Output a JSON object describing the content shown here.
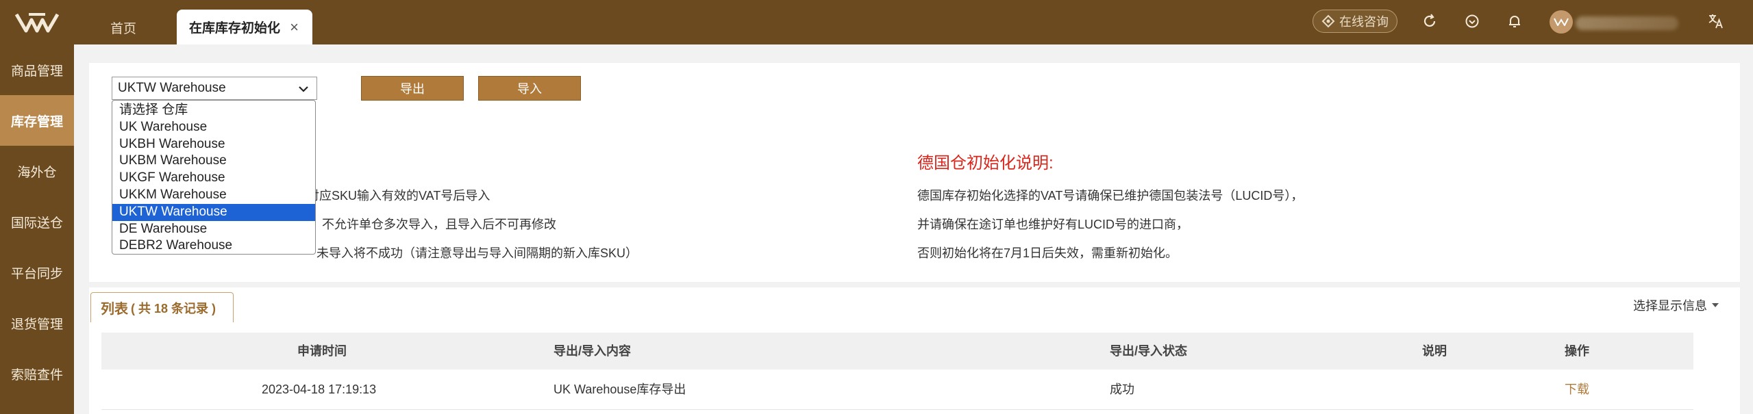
{
  "colors": {
    "brand_dark": "#6b4a1f",
    "brand_light": "#b8884c",
    "button": "#b07a3a",
    "alert_red": "#d9261c",
    "selected_blue": "#1e63d6"
  },
  "tabs": {
    "home": "首页",
    "active": "在库库存初始化",
    "close": "×"
  },
  "header": {
    "consult_label": "在线咨询",
    "icons": [
      "refresh-icon",
      "support-icon",
      "bell-icon",
      "language-icon"
    ]
  },
  "sidebar": {
    "items": [
      {
        "label": "商品管理"
      },
      {
        "label": "库存管理"
      },
      {
        "label": "海外仓"
      },
      {
        "label": "国际送仓"
      },
      {
        "label": "平台同步"
      },
      {
        "label": "退货管理"
      },
      {
        "label": "索赔查件"
      }
    ]
  },
  "toolbar": {
    "warehouse_selected": "UKTW Warehouse",
    "export_label": "导出",
    "import_label": "导入",
    "options": [
      "请选择 仓库",
      "UK Warehouse",
      "UKBH Warehouse",
      "UKBM Warehouse",
      "UKGF Warehouse",
      "UKKM Warehouse",
      "UKTW Warehouse",
      "DE Warehouse",
      "DEBR2 Warehouse"
    ]
  },
  "notes_left": [
    "入对应SKU输入有效的VAT号后导入",
    "不允许单仓多次导入，且导入后不可再修改",
    "未导入将不成功（请注意导出与导入间隔期的新入库SKU）"
  ],
  "de_notes": {
    "title": "德国仓初始化说明:",
    "lines": [
      "德国库存初始化选择的VAT号请确保已维护德国包装法号（LUCID号），",
      "并请确保在途订单也维护好有LUCID号的进口商，",
      "否则初始化将在7月1日后失效，需重新初始化。"
    ]
  },
  "list": {
    "tab_label": "列表",
    "count_text": "( 共 18 条记录 )",
    "column_toggle": "选择显示信息",
    "headers": {
      "time": "申请时间",
      "content": "导出/导入内容",
      "status": "导出/导入状态",
      "note": "说明",
      "action": "操作"
    },
    "rows": [
      {
        "time": "2023-04-18 17:19:13",
        "content": "UK Warehouse库存导出",
        "status": "成功",
        "note": "",
        "action": "下载"
      }
    ]
  }
}
